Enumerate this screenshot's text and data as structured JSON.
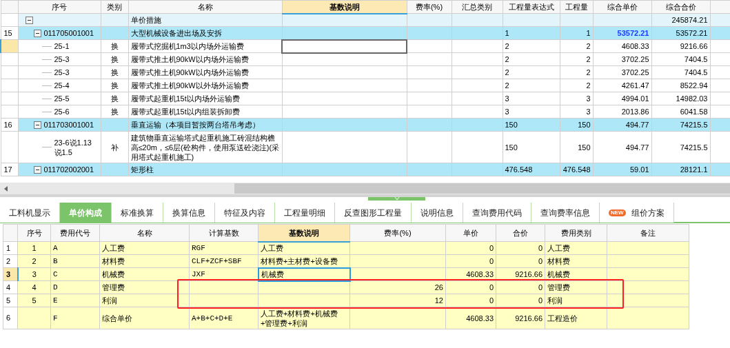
{
  "top_table": {
    "columns": [
      {
        "label": "序号",
        "highlighted": false
      },
      {
        "label": "类别",
        "highlighted": false
      },
      {
        "label": "名称",
        "highlighted": false
      },
      {
        "label": "基数说明",
        "highlighted": true
      },
      {
        "label": "费率(%)",
        "highlighted": false
      },
      {
        "label": "汇总类别",
        "highlighted": false
      },
      {
        "label": "工程量表达式",
        "highlighted": false
      },
      {
        "label": "工程量",
        "highlighted": false
      },
      {
        "label": "综合单价",
        "highlighted": false
      },
      {
        "label": "综合合价",
        "highlighted": false
      }
    ],
    "rows": [
      {
        "kind": "group",
        "expanded": true,
        "selected": false,
        "price_highlight": false,
        "name": "单价措施",
        "total": "245874.21"
      },
      {
        "kind": "item",
        "expanded": true,
        "selected": false,
        "price_highlight": true,
        "num": "15",
        "code": "011705001001",
        "name": "大型机械设备进出场及安拆",
        "expr": "1",
        "qty": "1",
        "unit_price": "53572.21",
        "total": "53572.21"
      },
      {
        "kind": "sub",
        "selected": true,
        "price_highlight": false,
        "code": "25-1",
        "type": "换",
        "name": "履带式挖掘机1m3以内场外运输费",
        "expr": "2",
        "qty": "2",
        "unit_price": "4608.33",
        "total": "9216.66"
      },
      {
        "kind": "sub",
        "selected": false,
        "price_highlight": false,
        "code": "25-3",
        "type": "换",
        "name": "履带式推土机90kW以内场外运输费",
        "expr": "2",
        "qty": "2",
        "unit_price": "3702.25",
        "total": "7404.5"
      },
      {
        "kind": "sub",
        "selected": false,
        "price_highlight": false,
        "code": "25-3",
        "type": "换",
        "name": "履带式推土机90kW以内场外运输费",
        "expr": "2",
        "qty": "2",
        "unit_price": "3702.25",
        "total": "7404.5"
      },
      {
        "kind": "sub",
        "selected": false,
        "price_highlight": false,
        "code": "25-4",
        "type": "换",
        "name": "履带式推土机90kW以外场外运输费",
        "expr": "2",
        "qty": "2",
        "unit_price": "4261.47",
        "total": "8522.94"
      },
      {
        "kind": "sub",
        "selected": false,
        "price_highlight": false,
        "code": "25-5",
        "type": "换",
        "name": "履带式起重机15t以内场外运输费",
        "expr": "3",
        "qty": "3",
        "unit_price": "4994.01",
        "total": "14982.03"
      },
      {
        "kind": "sub",
        "selected": false,
        "price_highlight": false,
        "code": "25-6",
        "type": "换",
        "name": "履带式起重机15t以内组装拆卸费",
        "expr": "3",
        "qty": "3",
        "unit_price": "2013.86",
        "total": "6041.58"
      },
      {
        "kind": "item",
        "expanded": true,
        "selected": false,
        "price_highlight": false,
        "num": "16",
        "code": "011703001001",
        "name": "垂直运输（本项目暂按两台塔吊考虑）",
        "expr": "150",
        "qty": "150",
        "unit_price": "494.77",
        "total": "74215.5"
      },
      {
        "kind": "sub",
        "selected": false,
        "price_highlight": false,
        "code": "23-6说1.13 说1.5",
        "type": "补",
        "name": "建筑物垂直运输塔式起重机施工砖混结构檐高≤20m，≤6层(砼构件，使用泵送砼浇注)(采用塔式起重机施工)",
        "expr": "150",
        "qty": "150",
        "unit_price": "494.77",
        "total": "74215.5"
      },
      {
        "kind": "item",
        "expanded": true,
        "selected": false,
        "price_highlight": false,
        "num": "17",
        "code": "011702002001",
        "name": "矩形柱",
        "expr": "476.548",
        "qty": "476.548",
        "unit_price": "59.01",
        "total": "28121.1"
      }
    ]
  },
  "tabs": [
    {
      "label": "工料机显示",
      "selected": false
    },
    {
      "label": "单价构成",
      "selected": true
    },
    {
      "label": "标准换算",
      "selected": false
    },
    {
      "label": "换算信息",
      "selected": false
    },
    {
      "label": "特征及内容",
      "selected": false
    },
    {
      "label": "工程量明细",
      "selected": false
    },
    {
      "label": "反查图形工程量",
      "selected": false
    },
    {
      "label": "说明信息",
      "selected": false
    },
    {
      "label": "查询费用代码",
      "selected": false
    },
    {
      "label": "查询费率信息",
      "selected": false
    },
    {
      "label": "组价方案",
      "selected": false,
      "badge": "NEW"
    }
  ],
  "bottom_table": {
    "columns": [
      {
        "label": "序号",
        "highlighted": false
      },
      {
        "label": "费用代号",
        "highlighted": false
      },
      {
        "label": "名称",
        "highlighted": false
      },
      {
        "label": "计算基数",
        "highlighted": false
      },
      {
        "label": "基数说明",
        "highlighted": true
      },
      {
        "label": "费率(%)",
        "highlighted": false
      },
      {
        "label": "单价",
        "highlighted": false
      },
      {
        "label": "合价",
        "highlighted": false
      },
      {
        "label": "费用类别",
        "highlighted": false
      },
      {
        "label": "备注",
        "highlighted": false
      }
    ],
    "rows": [
      {
        "row": "1",
        "selected": false,
        "seq": "1",
        "code": "A",
        "name": "人工费",
        "base": "RGF",
        "base_note": "人工费",
        "unit": "0",
        "total": "0",
        "category": "人工费"
      },
      {
        "row": "2",
        "selected": false,
        "seq": "2",
        "code": "B",
        "name": "材料费",
        "base": "CLF+ZCF+SBF",
        "base_note": "材料费+主材费+设备费",
        "unit": "0",
        "total": "0",
        "category": "材料费"
      },
      {
        "row": "3",
        "selected": true,
        "seq": "3",
        "code": "C",
        "name": "机械费",
        "base": "JXF",
        "base_note": "机械费",
        "unit": "4608.33",
        "total": "9216.66",
        "category": "机械费"
      },
      {
        "row": "4",
        "selected": false,
        "seq": "4",
        "code": "D",
        "name": "管理费",
        "rate": "26",
        "unit": "0",
        "total": "0",
        "category": "管理费"
      },
      {
        "row": "5",
        "selected": false,
        "seq": "5",
        "code": "E",
        "name": "利润",
        "rate": "12",
        "unit": "0",
        "total": "0",
        "category": "利润"
      },
      {
        "row": "6",
        "selected": false,
        "code": "F",
        "name": "综合单价",
        "base": "A+B+C+D+E",
        "base_note": "人工费+材料费+机械费+管理费+利润",
        "unit": "4608.33",
        "total": "9216.66",
        "category": "工程造价"
      }
    ]
  }
}
